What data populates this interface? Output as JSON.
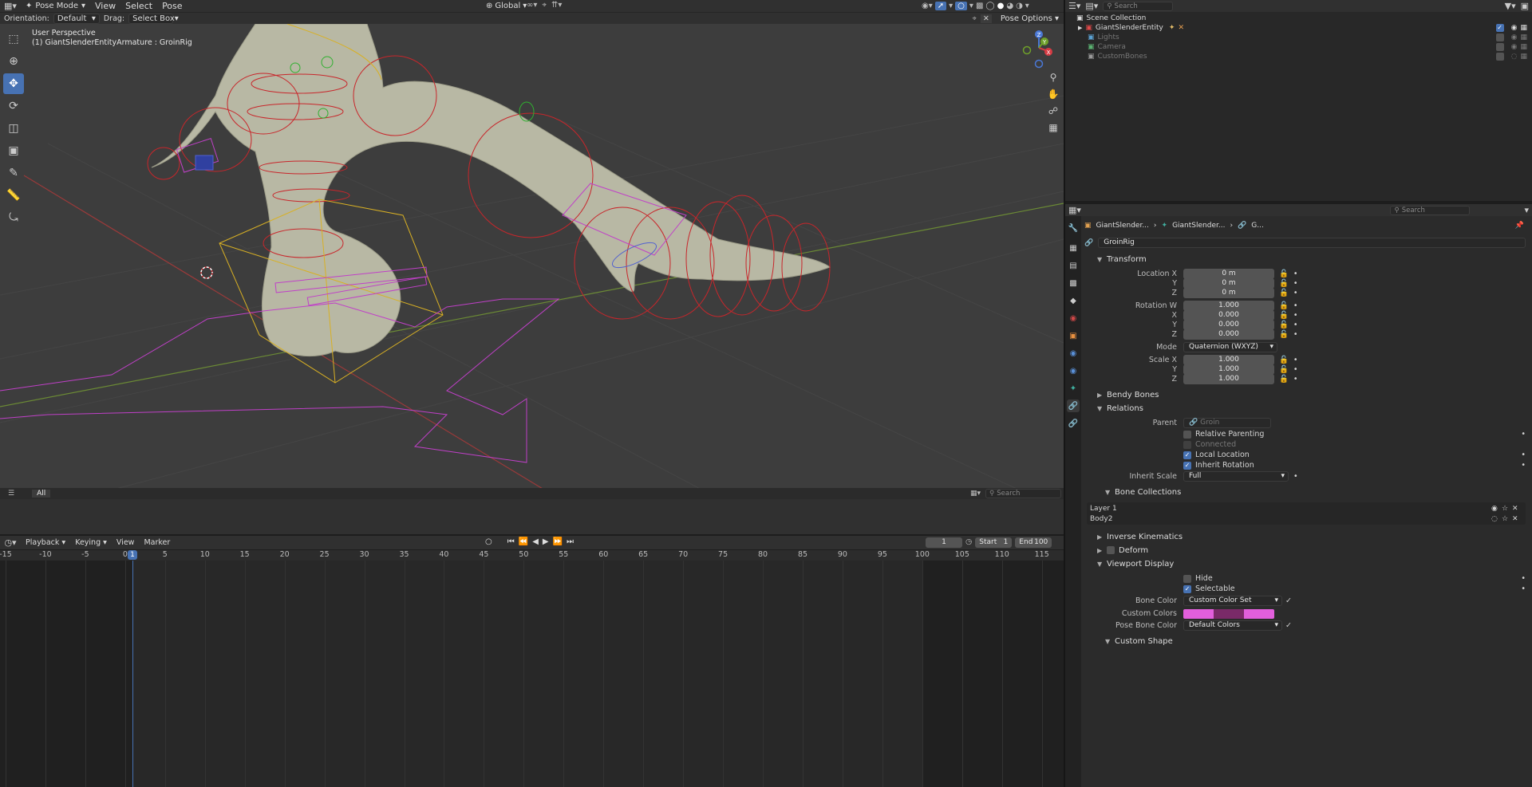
{
  "topbar": {
    "mode": "Pose Mode",
    "menus": [
      "View",
      "Select",
      "Pose"
    ],
    "transform_orientation": "Global",
    "pose_options": "Pose Options"
  },
  "tool_settings": {
    "orientation_label": "Orientation:",
    "orientation_value": "Default",
    "drag_label": "Drag:",
    "drag_value": "Select Box"
  },
  "viewport": {
    "view_name": "User Perspective",
    "active_object": "(1) GiantSlenderEntityArmature : GroinRig",
    "collection_tab": "All",
    "search_placeholder": "Search",
    "axis_labels": {
      "z": "Z",
      "y": "Y",
      "x": "X"
    }
  },
  "outliner": {
    "search_placeholder": "Search",
    "root": "Scene Collection",
    "items": [
      {
        "name": "GiantSlenderEntity",
        "enabled": true
      },
      {
        "name": "Lights",
        "enabled": false
      },
      {
        "name": "Camera",
        "enabled": false
      },
      {
        "name": "CustomBones",
        "enabled": false
      }
    ]
  },
  "properties": {
    "search_placeholder": "Search",
    "breadcrumb": [
      "GiantSlender...",
      "GiantSlender...",
      "G..."
    ],
    "bone_name": "GroinRig",
    "transform": {
      "title": "Transform",
      "location_label": "Location X",
      "location": [
        "0 m",
        "0 m",
        "0 m"
      ],
      "rotation_label": "Rotation W",
      "rotation": [
        "1.000",
        "0.000",
        "0.000",
        "0.000"
      ],
      "mode_label": "Mode",
      "mode": "Quaternion (WXYZ)",
      "scale_label": "Scale X",
      "scale": [
        "1.000",
        "1.000",
        "1.000"
      ],
      "y_label": "Y",
      "z_label": "Z",
      "x_label": "X"
    },
    "bendy_bones": "Bendy Bones",
    "relations": {
      "title": "Relations",
      "parent_label": "Parent",
      "parent": "Groin",
      "relative_parenting": "Relative Parenting",
      "connected": "Connected",
      "local_location": "Local Location",
      "inherit_rotation": "Inherit Rotation",
      "inherit_scale_label": "Inherit Scale",
      "inherit_scale": "Full",
      "bone_collections": "Bone Collections",
      "collections": [
        "Layer 1",
        "Body2"
      ]
    },
    "inverse_kinematics": "Inverse Kinematics",
    "deform": "Deform",
    "viewport_display": {
      "title": "Viewport Display",
      "hide": "Hide",
      "selectable": "Selectable",
      "bone_color_label": "Bone Color",
      "bone_color": "Custom Color Set",
      "custom_colors_label": "Custom Colors",
      "custom_colors": [
        "#e25fdc",
        "#7a2a68",
        "#e25fdc"
      ],
      "pose_bone_color_label": "Pose Bone Color",
      "pose_bone_color": "Default Colors",
      "custom_shape": "Custom Shape"
    }
  },
  "timeline": {
    "menus": [
      "Playback",
      "Keying",
      "View",
      "Marker"
    ],
    "current_frame": "1",
    "start_label": "Start",
    "start": "1",
    "end_label": "End",
    "end": "100",
    "ruler": [
      "-15",
      "-10",
      "-5",
      "0",
      "5",
      "10",
      "15",
      "20",
      "25",
      "30",
      "35",
      "40",
      "45",
      "50",
      "55",
      "60",
      "65",
      "70",
      "75",
      "80",
      "85",
      "90",
      "95",
      "100",
      "105",
      "110",
      "115"
    ],
    "playhead": "1"
  },
  "colors": {
    "accent": "#4772b3",
    "bone_red": "#c8262b",
    "bone_magenta": "#c040c8",
    "bone_yellow": "#d8b024",
    "bone_green": "#30b030"
  }
}
